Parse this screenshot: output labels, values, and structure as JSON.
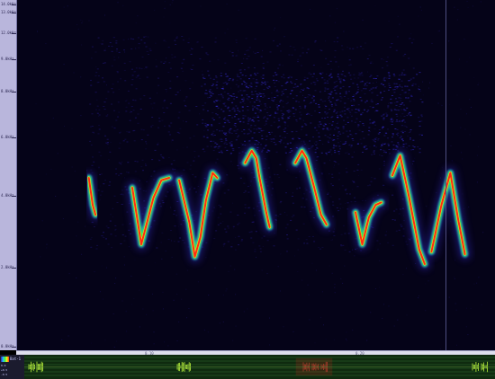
{
  "frequency_axis": {
    "unit": "kHz",
    "ticks": [
      "14.0kHz",
      "13.0kHz",
      "12.0kHz",
      "9.0kHz",
      "8.0kHz",
      "6.0kHz",
      "4.0kHz",
      "2.0kHz",
      "0.0kHz"
    ]
  },
  "scroll_bar": {
    "markers": [
      "0.10",
      "0.20"
    ]
  },
  "overview": {
    "channel_label": "Bat-1",
    "side_values": [
      "0.0",
      "+0.5",
      "-0.5"
    ],
    "highlight_color": "#ff2020"
  },
  "colors": {
    "background": "#050318",
    "noise": "#2a1fa0",
    "halo": "#3a30e6",
    "low": "#27b5ff",
    "mid": "#3cf04a",
    "high": "#f4f415",
    "peak": "#ff2a14",
    "waveform": "#b8f23c"
  },
  "calls": [
    [
      [
        0.1,
        7.0
      ],
      [
        0.45,
        5.9
      ],
      [
        0.7,
        5.5
      ]
    ],
    [
      [
        0.0,
        6.6
      ],
      [
        0.8,
        4.3
      ],
      [
        1.9,
        6.2
      ],
      [
        2.6,
        6.9
      ],
      [
        3.3,
        7.0
      ]
    ],
    [
      [
        0.0,
        6.9
      ],
      [
        0.9,
        5.2
      ],
      [
        1.4,
        3.8
      ],
      [
        1.9,
        4.6
      ],
      [
        2.4,
        6.1
      ],
      [
        3.0,
        7.2
      ],
      [
        3.4,
        7.0
      ]
    ],
    [
      [
        0.0,
        7.6
      ],
      [
        0.6,
        8.1
      ],
      [
        1.0,
        7.8
      ],
      [
        1.3,
        7.0
      ],
      [
        1.9,
        5.6
      ],
      [
        2.2,
        5.0
      ]
    ],
    [
      [
        0.0,
        7.6
      ],
      [
        0.6,
        8.1
      ],
      [
        1.0,
        7.8
      ],
      [
        1.7,
        6.6
      ],
      [
        2.3,
        5.5
      ],
      [
        2.8,
        5.1
      ]
    ],
    [
      [
        0.0,
        5.6
      ],
      [
        0.6,
        4.3
      ],
      [
        1.2,
        5.4
      ],
      [
        1.8,
        5.9
      ],
      [
        2.3,
        6.0
      ]
    ],
    [
      [
        0.0,
        7.1
      ],
      [
        0.7,
        7.9
      ],
      [
        1.5,
        6.2
      ],
      [
        2.4,
        4.1
      ],
      [
        2.9,
        3.5
      ]
    ],
    [
      [
        0.0,
        4.0
      ],
      [
        0.9,
        5.9
      ],
      [
        1.7,
        7.2
      ],
      [
        2.4,
        5.3
      ],
      [
        3.0,
        3.9
      ]
    ]
  ],
  "call_times": [
    0.6,
    4.6,
    8.8,
    14.7,
    19.2,
    24.6,
    27.9,
    31.4
  ]
}
